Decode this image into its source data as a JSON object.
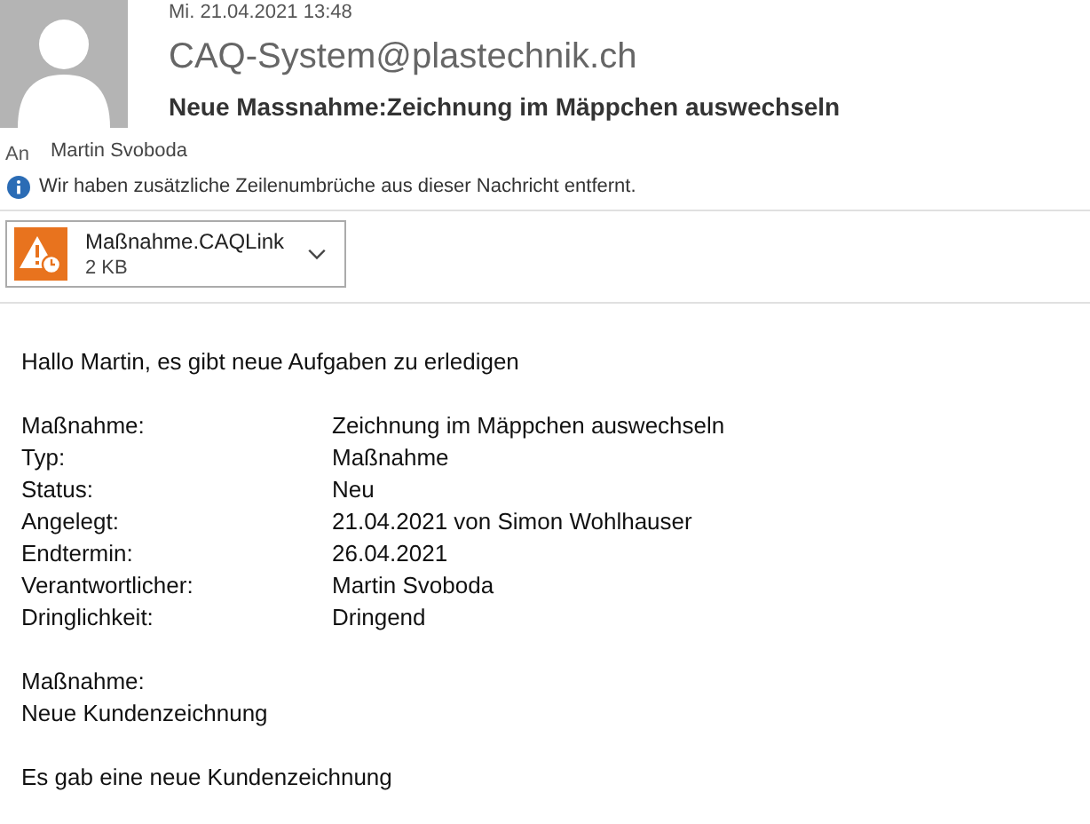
{
  "header": {
    "date": "Mi. 21.04.2021 13:48",
    "sender": "CAQ-System@plastechnik.ch",
    "subject": "Neue Massnahme:Zeichnung im Mäppchen auswechseln",
    "to_label": "An",
    "to": "Martin Svoboda",
    "info": "Wir haben zusätzliche Zeilenumbrüche aus dieser Nachricht entfernt."
  },
  "attachment": {
    "name": "Maßnahme.CAQLink",
    "size": "2 KB"
  },
  "body": {
    "greeting": "Hallo Martin, es gibt neue Aufgaben zu erledigen",
    "fields": [
      {
        "label": "Maßnahme:",
        "value": "Zeichnung im Mäppchen auswechseln"
      },
      {
        "label": "Typ:",
        "value": "Maßnahme"
      },
      {
        "label": "Status:",
        "value": "Neu"
      },
      {
        "label": "Angelegt:",
        "value": "21.04.2021 von Simon Wohlhauser"
      },
      {
        "label": "Endtermin:",
        "value": "26.04.2021"
      },
      {
        "label": "Verantwortlicher:",
        "value": "Martin Svoboda"
      },
      {
        "label": "Dringlichkeit:",
        "value": "Dringend"
      }
    ],
    "section_label": "Maßnahme:",
    "section_text": "Neue Kundenzeichnung",
    "last_line": "Es gab eine neue Kundenzeichnung"
  }
}
